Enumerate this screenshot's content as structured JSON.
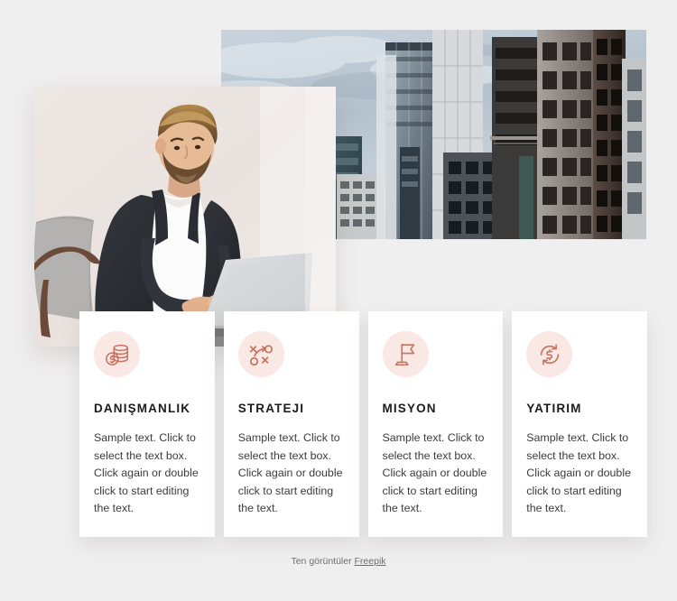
{
  "page": {
    "background_color": "#f0efef"
  },
  "media": {
    "city_photo": {
      "alt": "city-skyline-office-buildings-photo",
      "sky_color": "#b9c7d2",
      "building_color": "#6e7a84"
    },
    "man_photo": {
      "alt": "businessman-working-on-laptop-photo",
      "background_color": "#ece5e2",
      "suit_color": "#2b2d33",
      "chair_color": "#a8a6a4"
    }
  },
  "theme": {
    "icon_circle_color": "#fae8e4",
    "icon_stroke_color": "#c9705f",
    "card_background": "#ffffff",
    "title_color": "#1b1b1b",
    "body_color": "#3b3b3b"
  },
  "cards": [
    {
      "icon": "coins-stack-dollar-icon",
      "title": "DANIŞMANLIK",
      "body": "Sample text. Click to select the text box. Click again or double click to start editing the text."
    },
    {
      "icon": "strategy-playbook-icon",
      "title": "STRATEJI",
      "body": "Sample text. Click to select the text box. Click again or double click to start editing the text."
    },
    {
      "icon": "flag-on-stand-icon",
      "title": "MISYON",
      "body": "Sample text. Click to select the text box. Click again or double click to start editing the text."
    },
    {
      "icon": "dollar-refresh-arrows-icon",
      "title": "YATIRIM",
      "body": "Sample text. Click to select the text box. Click again or double click to start editing the text."
    }
  ],
  "footer": {
    "credit_prefix": "Ten görüntüler ",
    "credit_brand": "Freepik"
  }
}
